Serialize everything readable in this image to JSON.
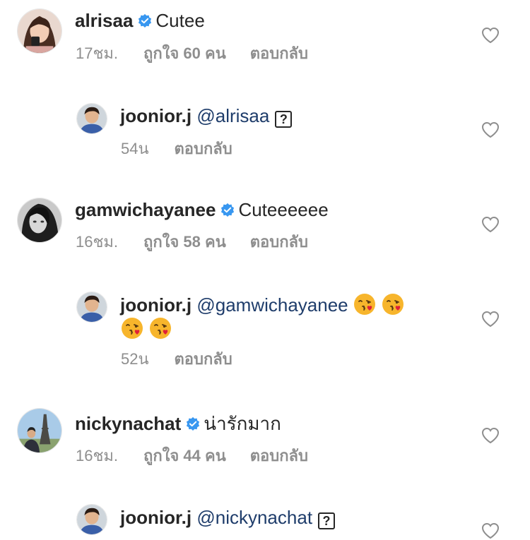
{
  "comments": [
    {
      "username": "alrisaa",
      "text": "Cutee",
      "time": "17ชม.",
      "likes": "ถูกใจ 60 คน",
      "reply_label": "ตอบกลับ"
    },
    {
      "username": "joonior.j",
      "mention": "@alrisaa",
      "glyph": "?",
      "time": "54น",
      "reply_label": "ตอบกลับ"
    },
    {
      "username": "gamwichayanee",
      "text": "Cuteeeeee",
      "time": "16ชม.",
      "likes": "ถูกใจ 58 คน",
      "reply_label": "ตอบกลับ"
    },
    {
      "username": "joonior.j",
      "mention": "@gamwichayanee",
      "emoji": "face-blowing-a-kiss",
      "emoji_count": 4,
      "time": "52น",
      "reply_label": "ตอบกลับ"
    },
    {
      "username": "nickynachat",
      "text": "น่ารักมาก",
      "time": "16ชม.",
      "likes": "ถูกใจ 44 คน",
      "reply_label": "ตอบกลับ"
    },
    {
      "username": "joonior.j",
      "mention": "@nickynachat",
      "glyph": "?"
    }
  ],
  "colors": {
    "verified_badge": "#3897f0",
    "mention": "#1f3d6b",
    "meta_text": "#8e8e8e",
    "heart_outline": "#8e8e8e"
  },
  "icons": {
    "verified": "verified-badge-icon",
    "like": "heart-outline-icon",
    "emoji": "kissing-face-emoji"
  }
}
